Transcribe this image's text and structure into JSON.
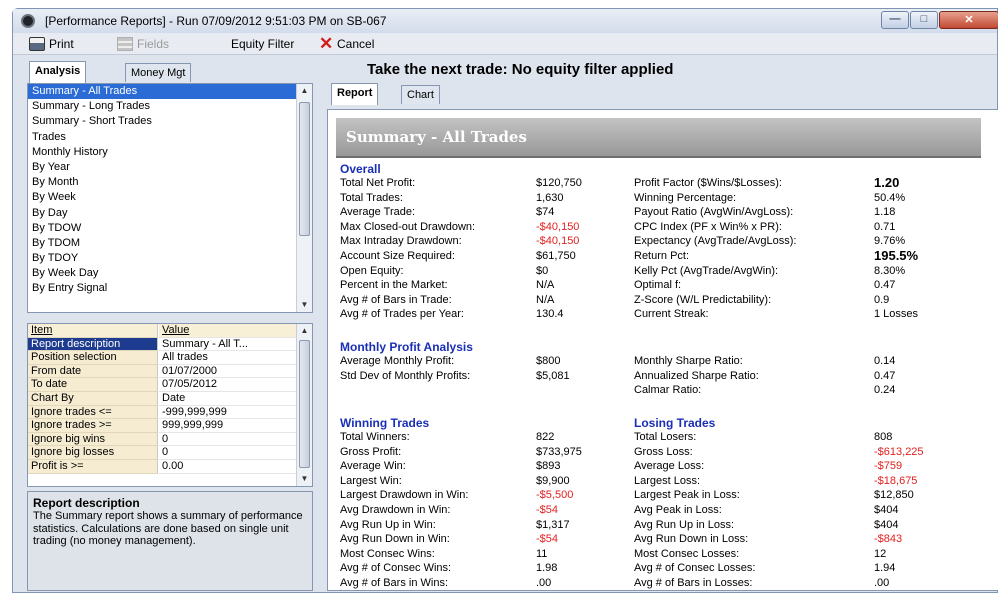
{
  "window": {
    "title": "[Performance Reports]  -  Run 07/09/2012 9:51:03 PM on SB-067"
  },
  "toolbar": {
    "print": "Print",
    "fields": "Fields",
    "equity_filter": "Equity Filter",
    "cancel": "Cancel"
  },
  "left": {
    "tabs": [
      "Analysis",
      "Money Mgt"
    ],
    "analysis_items": [
      "Summary - All Trades",
      "Summary - Long Trades",
      "Summary - Short Trades",
      "Trades",
      "Monthly History",
      "By Year",
      "By Month",
      "By Week",
      "By Day",
      "By TDOW",
      "By TDOM",
      "By TDOY",
      "By Week Day",
      "By Entry Signal"
    ],
    "grid_header": {
      "item": "Item",
      "value": "Value"
    },
    "grid_rows": [
      {
        "k": "Report description",
        "v": "Summary - All T..."
      },
      {
        "k": "Position selection",
        "v": "All trades"
      },
      {
        "k": "From date",
        "v": "01/07/2000"
      },
      {
        "k": "To date",
        "v": "07/05/2012"
      },
      {
        "k": "Chart By",
        "v": "Date"
      },
      {
        "k": "Ignore trades <=",
        "v": "-999,999,999"
      },
      {
        "k": "Ignore trades >=",
        "v": "999,999,999"
      },
      {
        "k": "Ignore big wins",
        "v": "0"
      },
      {
        "k": "Ignore big losses",
        "v": "0"
      },
      {
        "k": "Profit is >=",
        "v": "0.00"
      }
    ],
    "desc_title": "Report description",
    "desc_text": "The Summary report shows a summary of performance statistics.  Calculations are done based on single unit trading (no money management)."
  },
  "right": {
    "headline": "Take the next trade: No equity filter applied",
    "tabs": [
      "Report",
      "Chart"
    ],
    "banner": "Summary - All Trades",
    "overall": {
      "header": "Overall",
      "left": [
        {
          "label": "Total Net Profit:",
          "value": "$120,750"
        },
        {
          "label": "Total Trades:",
          "value": "1,630"
        },
        {
          "label": "Average Trade:",
          "value": "$74"
        },
        {
          "label": "Max Closed-out Drawdown:",
          "value": "-$40,150"
        },
        {
          "label": "Max Intraday Drawdown:",
          "value": "-$40,150"
        },
        {
          "label": "Account Size Required:",
          "value": "$61,750"
        },
        {
          "label": "Open Equity:",
          "value": "$0"
        },
        {
          "label": "Percent in the Market:",
          "value": "N/A"
        },
        {
          "label": "Avg # of Bars in Trade:",
          "value": "N/A"
        },
        {
          "label": "Avg # of Trades per Year:",
          "value": "130.4"
        }
      ],
      "right": [
        {
          "label": "Profit Factor ($Wins/$Losses):",
          "value": "1.20"
        },
        {
          "label": "Winning Percentage:",
          "value": "50.4%"
        },
        {
          "label": "Payout Ratio (AvgWin/AvgLoss):",
          "value": "1.18"
        },
        {
          "label": "CPC Index (PF x Win% x PR):",
          "value": "0.71"
        },
        {
          "label": "Expectancy (AvgTrade/AvgLoss):",
          "value": "9.76%"
        },
        {
          "label": "Return Pct:",
          "value": "195.5%"
        },
        {
          "label": "Kelly Pct (AvgTrade/AvgWin):",
          "value": "8.30%"
        },
        {
          "label": "Optimal f:",
          "value": "0.47"
        },
        {
          "label": "Z-Score (W/L Predictability):",
          "value": "0.9"
        },
        {
          "label": "Current Streak:",
          "value": "1 Losses"
        }
      ]
    },
    "monthly": {
      "header": "Monthly Profit Analysis",
      "left": [
        {
          "label": "Average Monthly Profit:",
          "value": "$800"
        },
        {
          "label": "Std Dev of Monthly Profits:",
          "value": "$5,081"
        }
      ],
      "right": [
        {
          "label": "Monthly Sharpe Ratio:",
          "value": "0.14"
        },
        {
          "label": "Annualized Sharpe Ratio:",
          "value": "0.47"
        },
        {
          "label": "Calmar Ratio:",
          "value": "0.24"
        }
      ]
    },
    "winning": {
      "header": "Winning Trades",
      "rows": [
        {
          "label": "Total Winners:",
          "value": "822"
        },
        {
          "label": "Gross Profit:",
          "value": "$733,975"
        },
        {
          "label": "Average Win:",
          "value": "$893"
        },
        {
          "label": "Largest Win:",
          "value": "$9,900"
        },
        {
          "label": "Largest Drawdown in Win:",
          "value": "-$5,500"
        },
        {
          "label": "Avg Drawdown in Win:",
          "value": "-$54"
        },
        {
          "label": "Avg Run Up in Win:",
          "value": "$1,317"
        },
        {
          "label": "Avg Run Down in Win:",
          "value": "-$54"
        },
        {
          "label": "Most Consec Wins:",
          "value": "11"
        },
        {
          "label": "Avg # of Consec Wins:",
          "value": "1.98"
        },
        {
          "label": "Avg # of Bars in Wins:",
          "value": ".00"
        }
      ]
    },
    "losing": {
      "header": "Losing Trades",
      "rows": [
        {
          "label": "Total Losers:",
          "value": "808"
        },
        {
          "label": "Gross Loss:",
          "value": "-$613,225"
        },
        {
          "label": "Average Loss:",
          "value": "-$759"
        },
        {
          "label": "Largest Loss:",
          "value": "-$18,675"
        },
        {
          "label": "Largest Peak in Loss:",
          "value": "$12,850"
        },
        {
          "label": "Avg Peak in Loss:",
          "value": "$404"
        },
        {
          "label": "Avg Run Up in Loss:",
          "value": "$404"
        },
        {
          "label": "Avg Run Down in Loss:",
          "value": "-$843"
        },
        {
          "label": "Most Consec Losses:",
          "value": "12"
        },
        {
          "label": "Avg # of Consec Losses:",
          "value": "1.94"
        },
        {
          "label": "Avg # of Bars in Losses:",
          "value": ".00"
        }
      ]
    }
  }
}
